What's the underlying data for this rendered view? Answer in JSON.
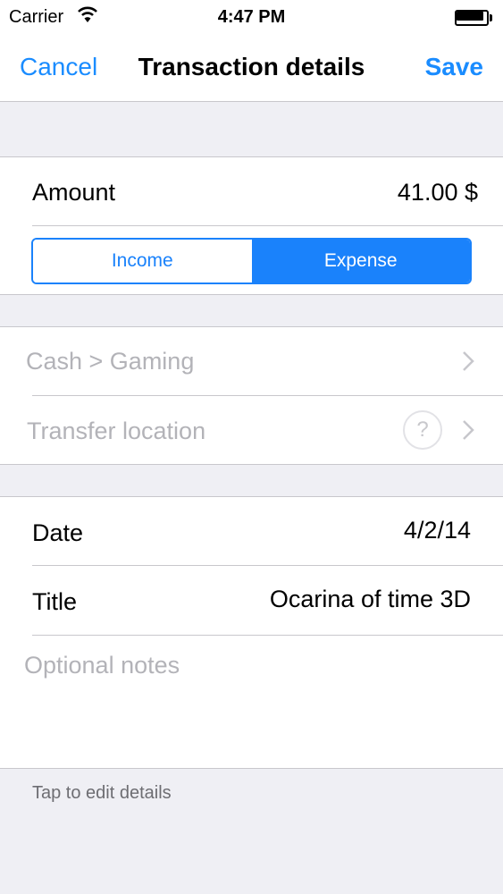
{
  "status_bar": {
    "carrier": "Carrier",
    "time": "4:47 PM"
  },
  "nav": {
    "cancel_label": "Cancel",
    "title": "Transaction details",
    "save_label": "Save"
  },
  "amount": {
    "label": "Amount",
    "value": "41.00 $"
  },
  "type_segment": {
    "options": [
      "Income",
      "Expense"
    ],
    "selected": "Expense"
  },
  "category": {
    "path": "Cash > Gaming"
  },
  "transfer": {
    "label": "Transfer location",
    "help_glyph": "?"
  },
  "date": {
    "label": "Date",
    "value": "4/2/14"
  },
  "title_field": {
    "label": "Title",
    "value": "Ocarina of time 3D"
  },
  "notes": {
    "placeholder": "Optional notes"
  },
  "footer": {
    "hint": "Tap to edit details"
  },
  "colors": {
    "accent": "#1a82fb",
    "background": "#efeff4",
    "separator": "#c8c7cc",
    "disabled_text": "#b3b3b8"
  }
}
